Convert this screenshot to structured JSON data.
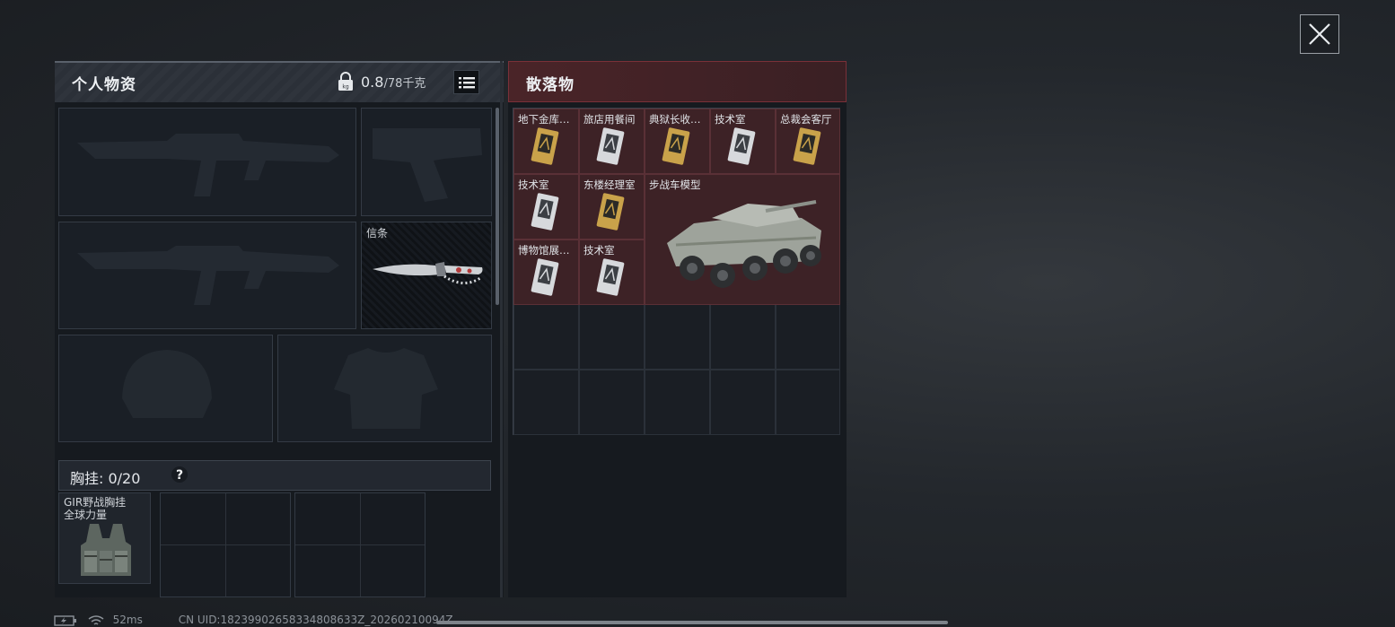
{
  "left_panel": {
    "title": "个人物资",
    "weight_current": "0.8",
    "weight_max": "/78千克",
    "melee_label": "信条",
    "chest_label": "胸挂: 0/20",
    "chest_help": "?",
    "rig_name_line1": "GIR野战胸挂",
    "rig_name_line2": "全球力量"
  },
  "right_panel": {
    "title": "散落物",
    "items": [
      {
        "name": "地下金库…",
        "card": "gold"
      },
      {
        "name": "旅店用餐间",
        "card": "silver"
      },
      {
        "name": "典狱长收…",
        "card": "gold"
      },
      {
        "name": "技术室",
        "card": "silver"
      },
      {
        "name": "总裁会客厅",
        "card": "gold"
      },
      {
        "name": "技术室",
        "card": "silver"
      },
      {
        "name": "东楼经理室",
        "card": "gold"
      },
      {
        "name": "步战车模型",
        "card": "vehicle"
      },
      {
        "name": "博物馆展…",
        "card": "silver"
      },
      {
        "name": "技术室",
        "card": "silver"
      }
    ]
  },
  "status_bar": {
    "ping": "52ms",
    "uid": "CN UID:18239902658334808633Z_20260210094Z"
  },
  "colors": {
    "loot_bg": "#3d2226",
    "header_red": "#4a2428",
    "gold_card": "#c9a24a",
    "silver_card": "#d7d9dc"
  }
}
